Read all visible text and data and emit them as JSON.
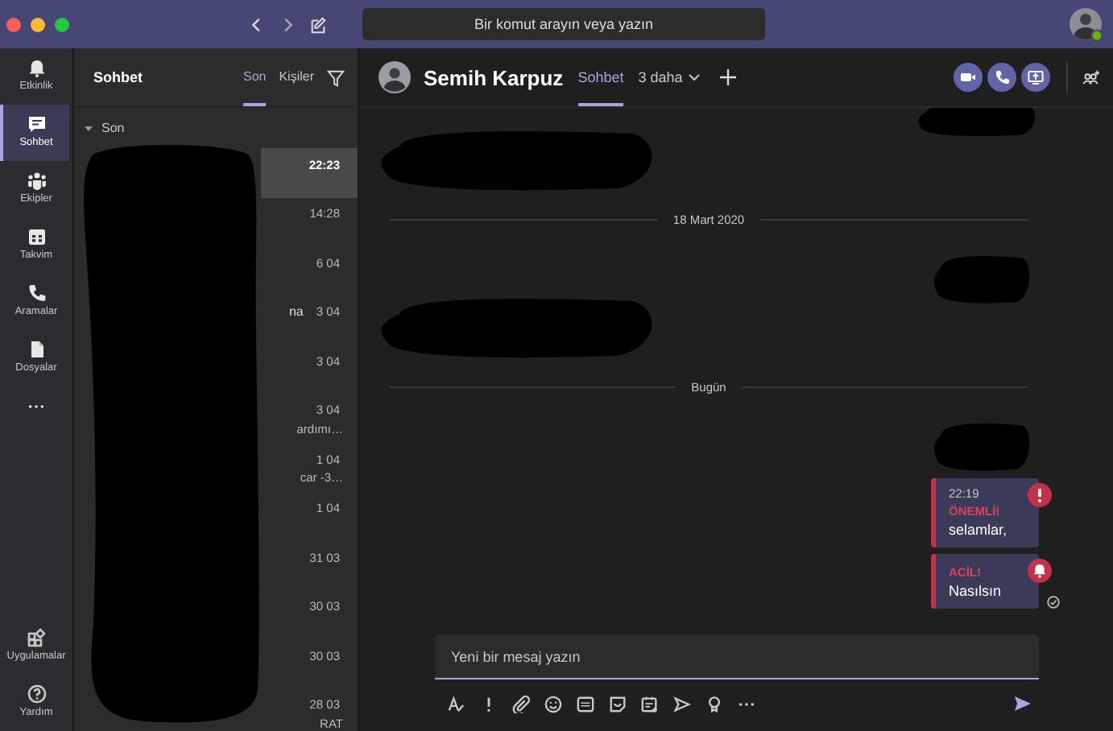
{
  "search": {
    "placeholder": "Bir komut arayın veya yazın"
  },
  "rail": {
    "items": [
      {
        "kind": "bell",
        "label": "Etkinlik",
        "selected": false
      },
      {
        "kind": "chat",
        "label": "Sohbet",
        "selected": true
      },
      {
        "kind": "teams",
        "label": "Ekipler",
        "selected": false
      },
      {
        "kind": "calendar",
        "label": "Takvim",
        "selected": false
      },
      {
        "kind": "phone",
        "label": "Aramalar",
        "selected": false
      },
      {
        "kind": "file",
        "label": "Dosyalar",
        "selected": false
      }
    ],
    "bottom_items": [
      {
        "kind": "apps",
        "label": "Uygulamalar",
        "selected": false
      },
      {
        "kind": "help",
        "label": "Yardım",
        "selected": false
      }
    ]
  },
  "chat_list": {
    "title": "Sohbet",
    "tabs": [
      {
        "label": "Son",
        "selected": true
      },
      {
        "label": "Kişiler",
        "selected": false
      }
    ],
    "section": {
      "label": "Son",
      "expanded": true
    },
    "redacted": true,
    "rows": [
      {
        "time": "22:23",
        "selected": true
      },
      {
        "time": "14:28",
        "selected": false
      },
      {
        "time": "6 04",
        "selected": false
      },
      {
        "time": "3 04",
        "selected": false,
        "name": "na"
      },
      {
        "time": "3 04",
        "selected": false
      },
      {
        "time": "3 04",
        "selected": false,
        "preview": "ardımı…"
      },
      {
        "time": "1 04",
        "selected": false,
        "preview": "car -3…"
      },
      {
        "time": "1 04",
        "selected": false
      },
      {
        "time": "31 03",
        "selected": false
      },
      {
        "time": "30 03",
        "selected": false
      },
      {
        "time": "30 03",
        "selected": false
      },
      {
        "time": "28 03",
        "selected": false,
        "preview": "RAT"
      }
    ]
  },
  "conversation": {
    "name": "Semih Karpuz",
    "tabs": [
      {
        "label": "Sohbet",
        "selected": true
      }
    ],
    "more_tabs": "3 daha",
    "timeline": [
      {
        "kind": "hidden",
        "own": true
      },
      {
        "kind": "hidden",
        "own": false
      },
      {
        "kind": "divider",
        "label": "18 Mart 2020"
      },
      {
        "kind": "hidden",
        "own": true
      },
      {
        "kind": "hidden",
        "own": false
      },
      {
        "kind": "divider",
        "label": "Bugün"
      },
      {
        "kind": "hidden",
        "own": true
      },
      {
        "kind": "important",
        "time": "22:19",
        "priority_label": "ÖNEMLİ!",
        "text": "selamlar,",
        "seen": false
      },
      {
        "kind": "urgent",
        "priority_label": "ACİL!",
        "text": "Nasılsın",
        "seen": true
      }
    ]
  },
  "compose": {
    "placeholder": "Yeni bir mesaj yazın",
    "tools": [
      {
        "kind": "format"
      },
      {
        "kind": "priority"
      },
      {
        "kind": "attach"
      },
      {
        "kind": "emoji"
      },
      {
        "kind": "gif"
      },
      {
        "kind": "sticker"
      },
      {
        "kind": "meeting"
      },
      {
        "kind": "stream"
      },
      {
        "kind": "praise"
      },
      {
        "kind": "more"
      }
    ]
  }
}
